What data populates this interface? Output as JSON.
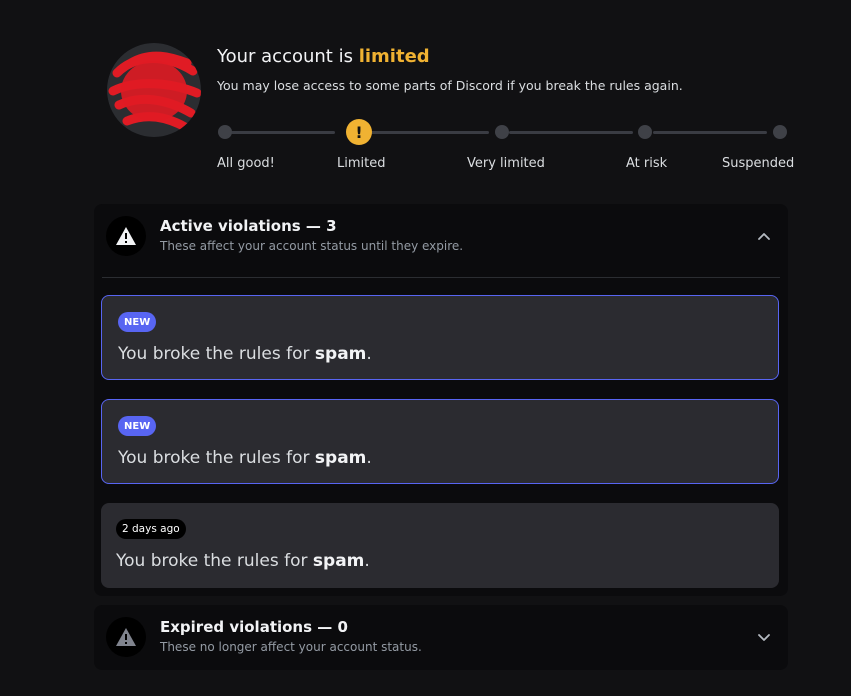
{
  "header": {
    "title_prefix": "Your account is",
    "title_status": "limited",
    "subtitle": "You may lose access to some parts of Discord if you break the rules again."
  },
  "status_track": {
    "current_stage": "Limited",
    "stages": [
      "All good!",
      "Limited",
      "Very limited",
      "At risk",
      "Suspended"
    ]
  },
  "active": {
    "title": "Active violations — 3",
    "subtitle": "These affect your account status until they expire.",
    "expanded": true,
    "violations": [
      {
        "badge": "NEW",
        "text_prefix": "You broke the rules for",
        "rule": "spam",
        "suffix": "."
      },
      {
        "badge": "NEW",
        "text_prefix": "You broke the rules for",
        "rule": "spam",
        "suffix": "."
      },
      {
        "badge": "2 days ago",
        "text_prefix": "You broke the rules for",
        "rule": "spam",
        "suffix": "."
      }
    ]
  },
  "expired": {
    "title": "Expired violations — 0",
    "subtitle": "These no longer affect your account status.",
    "expanded": false
  },
  "colors": {
    "background": "#111113",
    "accent_warning": "#f0b232",
    "new_badge": "#5865f2",
    "card": "#2b2b30"
  }
}
